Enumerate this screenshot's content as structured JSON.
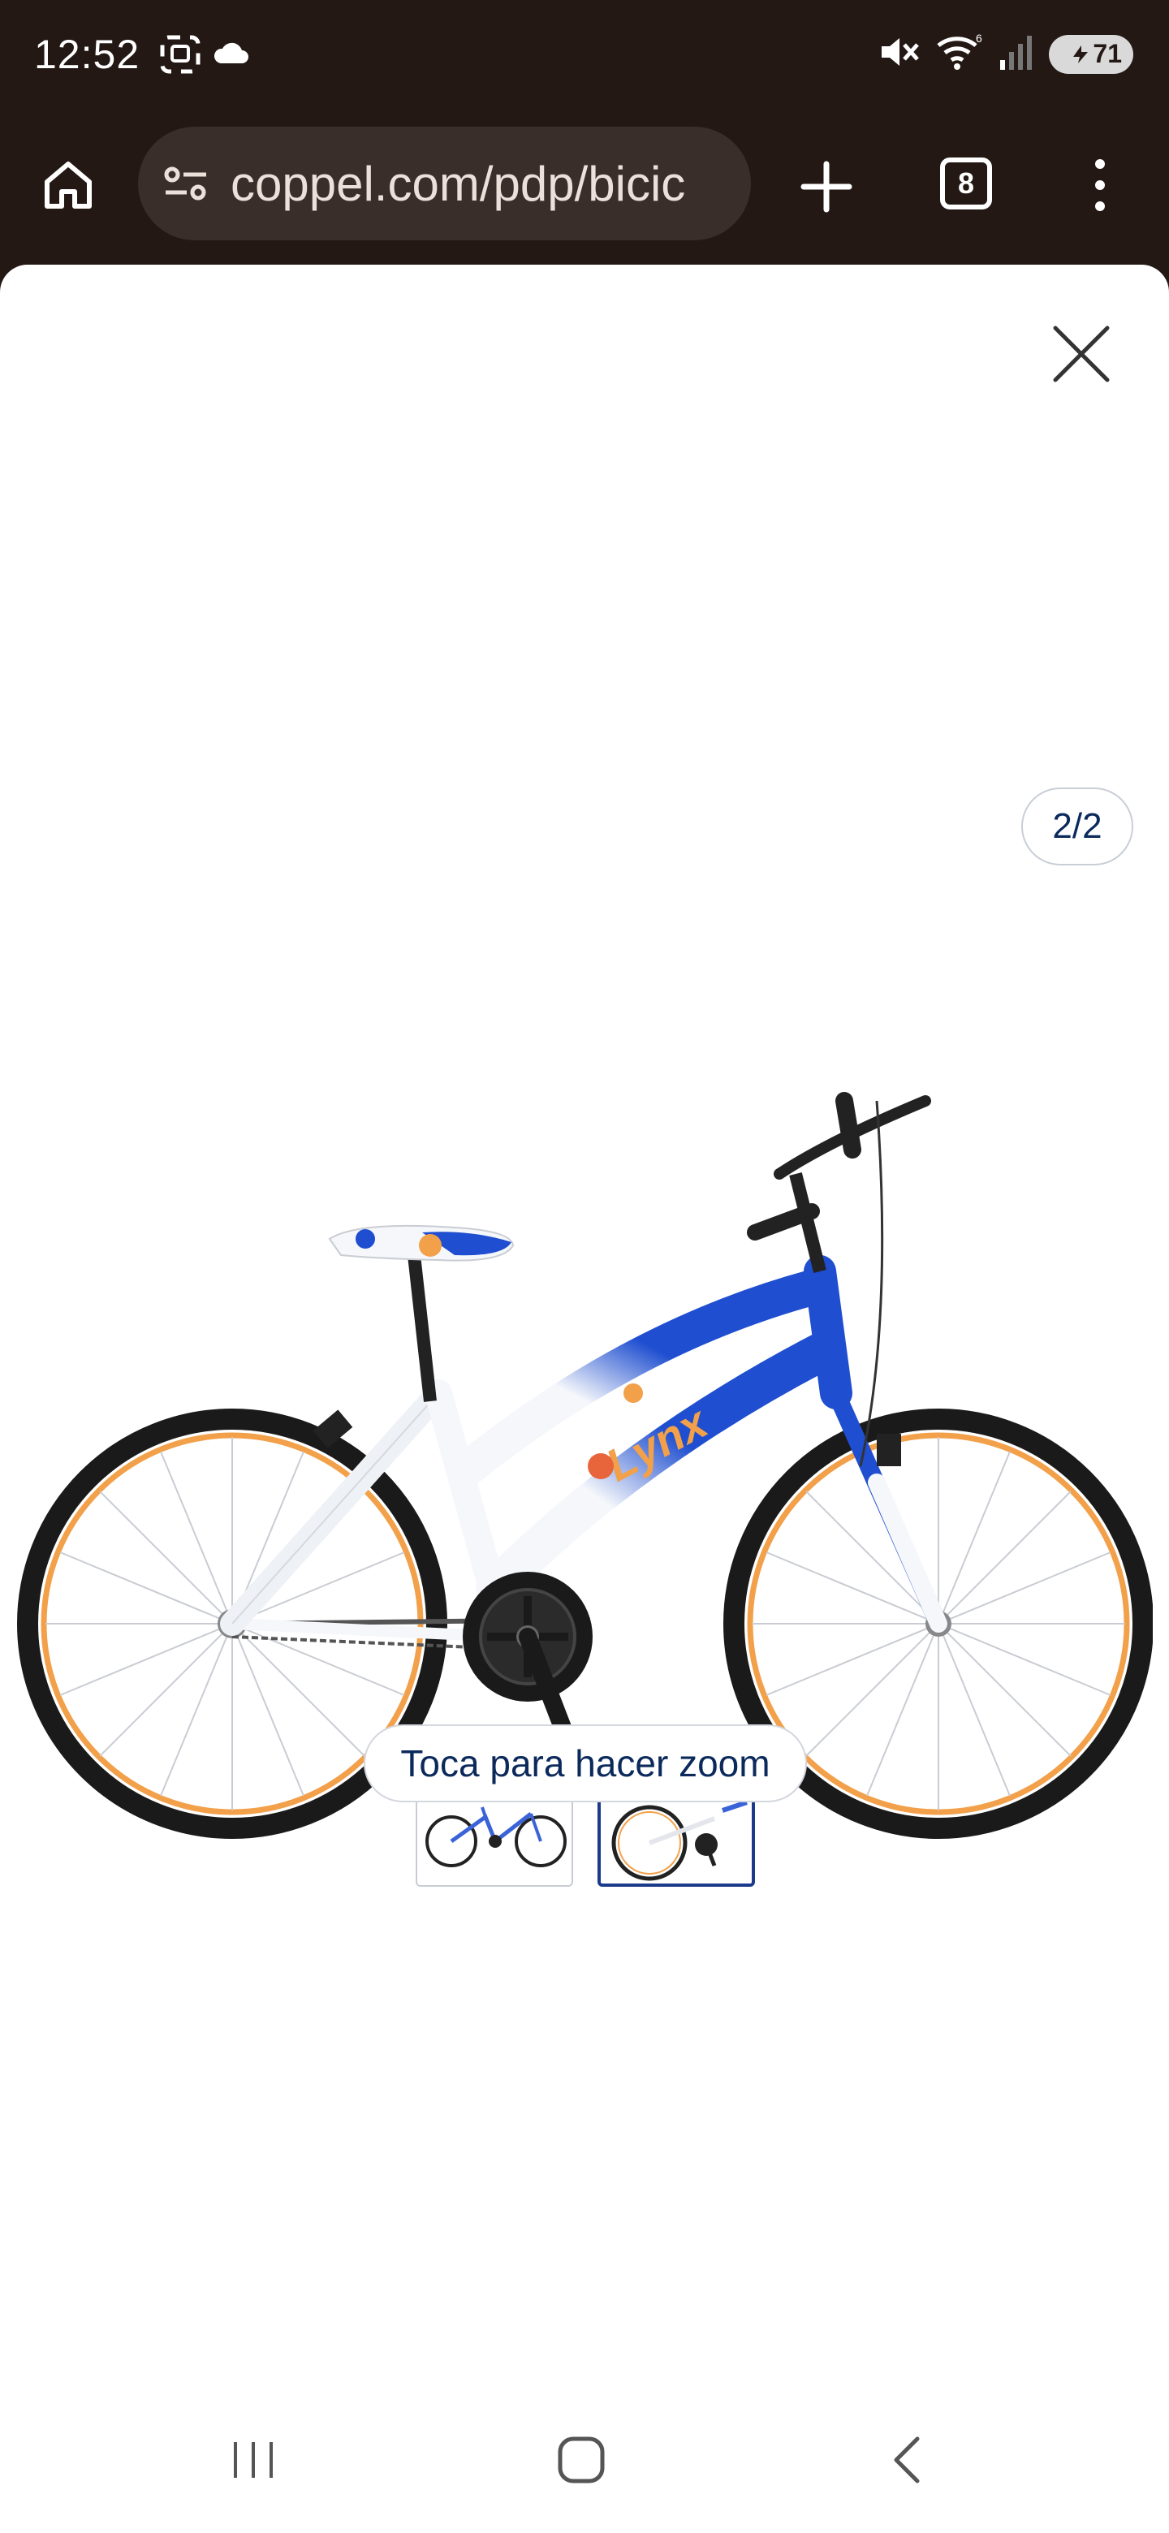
{
  "status_bar": {
    "time": "12:52",
    "battery": "71",
    "icons": [
      "screenshot-icon",
      "cloud-icon",
      "mute-icon",
      "wifi-icon",
      "signal-icon",
      "battery-icon"
    ]
  },
  "browser": {
    "url": "coppel.com/pdp/bicic",
    "tab_count": "8"
  },
  "gallery": {
    "counter": "2/2",
    "zoom_hint": "Toca para hacer zoom",
    "thumbnails": [
      "thumbnail-1",
      "thumbnail-2"
    ],
    "selected_thumbnail": 2
  },
  "product_image": {
    "brand_text": "Lynx",
    "colors": {
      "frame_blue": "#1f4fd0",
      "frame_white": "#f5f7fb",
      "rim_orange": "#f2a04a",
      "tire": "#1a1a1a"
    }
  },
  "nav": {
    "buttons": [
      "recents",
      "home",
      "back"
    ]
  }
}
